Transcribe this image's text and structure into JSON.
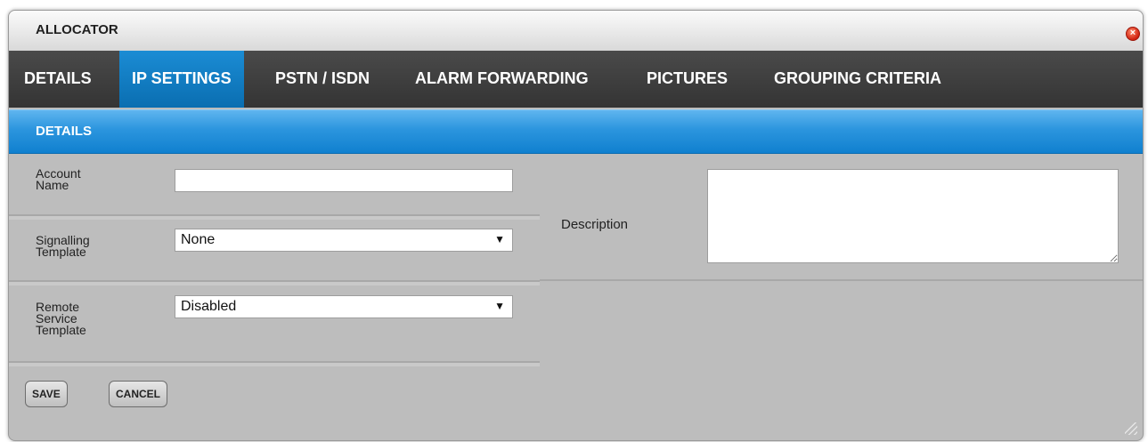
{
  "dialog": {
    "title": "ALLOCATOR",
    "close_icon": "close-icon"
  },
  "tabs": [
    {
      "label": "DETAILS",
      "active": false
    },
    {
      "label": "IP SETTINGS",
      "active": true
    },
    {
      "label": "PSTN / ISDN",
      "active": false
    },
    {
      "label": "ALARM FORWARDING",
      "active": false
    },
    {
      "label": "PICTURES",
      "active": false
    },
    {
      "label": "GROUPING CRITERIA",
      "active": false
    }
  ],
  "section": {
    "title": "DETAILS"
  },
  "form": {
    "account_name_label": "Account\nName",
    "account_name_value": "",
    "signalling_label": "Signalling\nTemplate",
    "signalling_value": "None",
    "remote_service_label": "Remote\nService\nTemplate",
    "remote_service_value": "Disabled",
    "description_label": "Description",
    "description_value": ""
  },
  "buttons": {
    "save": "SAVE",
    "cancel": "CANCEL"
  },
  "colors": {
    "accent": "#1b8cd4",
    "tab_bar": "#3d3d3d",
    "panel": "#bdbdbd"
  }
}
